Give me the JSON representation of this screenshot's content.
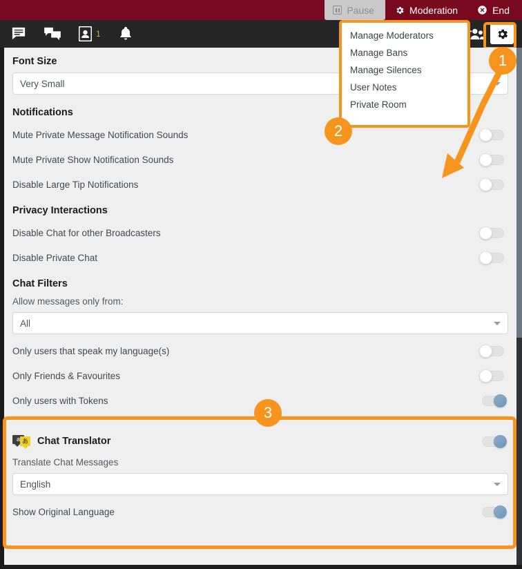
{
  "topbar": {
    "background": "#78091f",
    "buttons": [
      {
        "label": "Pause",
        "icon": "pause-icon",
        "state": "disabled"
      },
      {
        "label": "Moderation",
        "icon": "gear-icon",
        "state": "normal"
      },
      {
        "label": "End",
        "icon": "close-circle-icon",
        "state": "normal"
      }
    ]
  },
  "iconbar": {
    "background": "#262626",
    "left_icons": [
      {
        "name": "chat-message-icon",
        "count": ""
      },
      {
        "name": "conversations-icon",
        "count": ""
      },
      {
        "name": "user-card-icon",
        "count": "1"
      },
      {
        "name": "notifications-bell-icon",
        "count": ""
      }
    ],
    "right_icons": [
      {
        "name": "add-users-icon"
      },
      {
        "name": "settings-gear-icon"
      }
    ]
  },
  "moderation_menu": {
    "items": [
      "Manage Moderators",
      "Manage Bans",
      "Manage Silences",
      "User Notes",
      "Private Room"
    ]
  },
  "settings": {
    "font_size": {
      "heading": "Font Size",
      "value": "Very Small"
    },
    "notifications": {
      "heading": "Notifications",
      "rows": [
        {
          "label": "Mute Private Message Notification Sounds",
          "on": false
        },
        {
          "label": "Mute Private Show Notification Sounds",
          "on": false
        },
        {
          "label": "Disable Large Tip Notifications",
          "on": false
        }
      ]
    },
    "privacy": {
      "heading": "Privacy Interactions",
      "rows": [
        {
          "label": "Disable Chat for other Broadcasters",
          "on": false
        },
        {
          "label": "Disable Private Chat",
          "on": false
        }
      ]
    },
    "chat_filters": {
      "heading": "Chat Filters",
      "allow_label": "Allow messages only from:",
      "allow_value": "All",
      "rows": [
        {
          "label": "Only users that speak my language(s)",
          "on": false
        },
        {
          "label": "Only Friends & Favourites",
          "on": false
        },
        {
          "label": "Only users with Tokens",
          "on": true
        }
      ]
    },
    "chat_translator": {
      "heading": "Chat Translator",
      "icon": "translate-icon",
      "icon_glyph_left": "a",
      "icon_glyph_right": "あ",
      "enabled": true,
      "translate_label": "Translate Chat Messages",
      "language_value": "English",
      "show_original_label": "Show Original Language",
      "show_original_on": true
    }
  },
  "annotations": {
    "accent": "#f7941d",
    "badges": [
      "1",
      "2",
      "3"
    ]
  }
}
